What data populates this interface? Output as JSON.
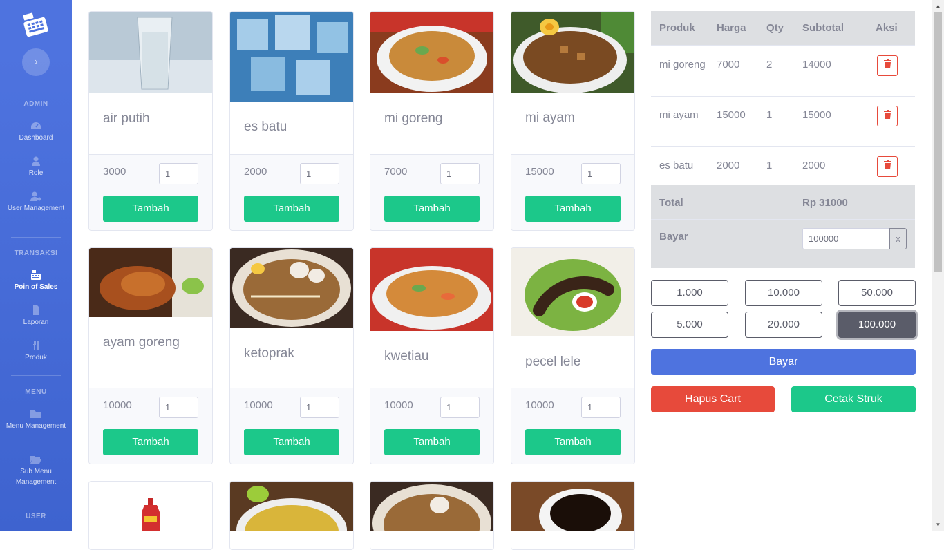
{
  "sidebar": {
    "toggle_icon": "chevron-right-icon",
    "sections": {
      "admin": "ADMIN",
      "transaksi": "TRANSAKSI",
      "menu": "MENU",
      "user": "USER"
    },
    "items": [
      {
        "label": "Dashboard",
        "icon": "tachometer-icon"
      },
      {
        "label": "Role",
        "icon": "user-tie-icon"
      },
      {
        "label": "User Management",
        "icon": "user-cog-icon"
      },
      {
        "label": "Poin of Sales",
        "icon": "cash-register-icon"
      },
      {
        "label": "Laporan",
        "icon": "file-icon"
      },
      {
        "label": "Produk",
        "icon": "utensils-icon"
      },
      {
        "label": "Menu Management",
        "icon": "folder-icon"
      },
      {
        "label": "Sub Menu Management",
        "icon": "folder-open-icon"
      }
    ]
  },
  "products": [
    {
      "name": "air putih",
      "price": "3000",
      "qty": "1",
      "button": "Tambah"
    },
    {
      "name": "es batu",
      "price": "2000",
      "qty": "1",
      "button": "Tambah"
    },
    {
      "name": "mi goreng",
      "price": "7000",
      "qty": "1",
      "button": "Tambah"
    },
    {
      "name": "mi ayam",
      "price": "15000",
      "qty": "1",
      "button": "Tambah"
    },
    {
      "name": "ayam goreng",
      "price": "10000",
      "qty": "1",
      "button": "Tambah"
    },
    {
      "name": "ketoprak",
      "price": "10000",
      "qty": "1",
      "button": "Tambah"
    },
    {
      "name": "kwetiau",
      "price": "10000",
      "qty": "1",
      "button": "Tambah"
    },
    {
      "name": "pecel lele",
      "price": "10000",
      "qty": "1",
      "button": "Tambah"
    }
  ],
  "cart": {
    "headers": [
      "Produk",
      "Harga",
      "Qty",
      "Subtotal",
      "Aksi"
    ],
    "rows": [
      {
        "produk": "mi goreng",
        "harga": "7000",
        "qty": "2",
        "subtotal": "14000"
      },
      {
        "produk": "mi ayam",
        "harga": "15000",
        "qty": "1",
        "subtotal": "15000"
      },
      {
        "produk": "es batu",
        "harga": "2000",
        "qty": "1",
        "subtotal": "2000"
      }
    ],
    "total_label": "Total",
    "total_value": "Rp 31000",
    "bayar_label": "Bayar",
    "bayar_value": "100000",
    "clear_label": "x"
  },
  "nominals": [
    "1.000",
    "10.000",
    "50.000",
    "5.000",
    "20.000",
    "100.000"
  ],
  "selected_nominal": "100.000",
  "buttons": {
    "bayar": "Bayar",
    "hapus": "Hapus Cart",
    "cetak": "Cetak Struk"
  },
  "colors": {
    "sidebar": "#4e73df",
    "success": "#1cc88a",
    "primary": "#4e73df",
    "danger": "#e74a3b",
    "dark": "#5a5c69"
  }
}
